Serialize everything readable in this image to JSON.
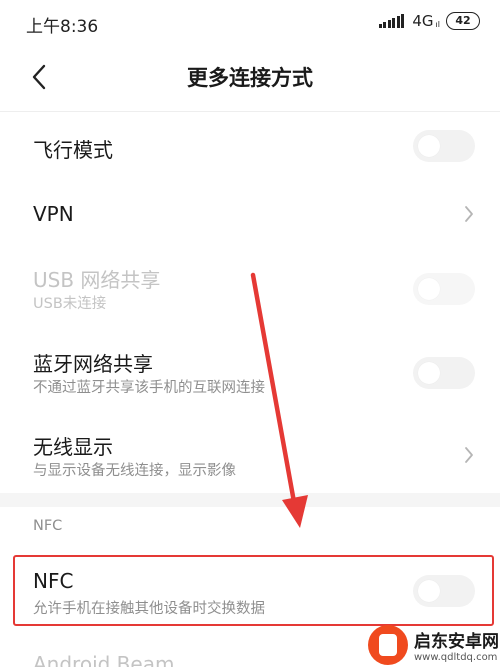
{
  "status_bar": {
    "time": "上午8:36",
    "network": "4G",
    "network_sub": "ıl",
    "battery": "42"
  },
  "header": {
    "title": "更多连接方式"
  },
  "rows": [
    {
      "title": "飞行模式",
      "control": "toggle",
      "on": false
    },
    {
      "title": "VPN",
      "control": "chevron"
    },
    {
      "title": "USB 网络共享",
      "subtitle": "USB未连接",
      "control": "toggle",
      "on": false,
      "disabled": true
    },
    {
      "title": "蓝牙网络共享",
      "subtitle": "不通过蓝牙共享该手机的互联网连接",
      "control": "toggle",
      "on": false
    },
    {
      "title": "无线显示",
      "subtitle": "与显示设备无线连接，显示影像",
      "control": "chevron"
    }
  ],
  "nfc_section": {
    "header": "NFC",
    "rows": [
      {
        "title": "NFC",
        "subtitle": "允许手机在接触其他设备时交换数据",
        "control": "toggle",
        "on": false
      },
      {
        "title": "Android Beam",
        "disabled": true
      }
    ]
  },
  "annotation": {
    "color": "#e53935"
  },
  "watermark": {
    "name": "启东安卓网",
    "url": "www.qdltdq.com"
  }
}
